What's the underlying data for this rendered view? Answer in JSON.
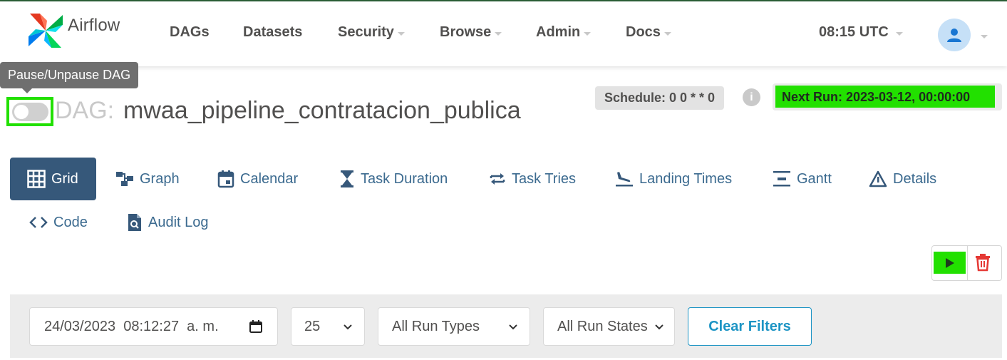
{
  "brand": {
    "name": "Airflow",
    "logo_icon": "airflow-pinwheel-icon"
  },
  "nav": {
    "items": [
      {
        "label": "DAGs",
        "dropdown": false
      },
      {
        "label": "Datasets",
        "dropdown": false
      },
      {
        "label": "Security",
        "dropdown": true
      },
      {
        "label": "Browse",
        "dropdown": true
      },
      {
        "label": "Admin",
        "dropdown": true
      },
      {
        "label": "Docs",
        "dropdown": true
      }
    ],
    "clock": "08:15 UTC",
    "user_icon": "user-icon"
  },
  "tooltip": {
    "text": "Pause/Unpause DAG"
  },
  "dag": {
    "label_prefix": "DAG:",
    "name": "mwaa_pipeline_contratacion_publica",
    "paused": true,
    "schedule": "Schedule: 0 0 * * 0",
    "info_icon": "i",
    "next_run": "Next Run: 2023-03-12, 00:00:00"
  },
  "tabs": [
    {
      "label": "Grid",
      "icon": "grid-icon",
      "active": true
    },
    {
      "label": "Graph",
      "icon": "graph-icon",
      "active": false
    },
    {
      "label": "Calendar",
      "icon": "calendar-icon",
      "active": false
    },
    {
      "label": "Task Duration",
      "icon": "hourglass-icon",
      "active": false
    },
    {
      "label": "Task Tries",
      "icon": "retry-arrows-icon",
      "active": false
    },
    {
      "label": "Landing Times",
      "icon": "plane-landing-icon",
      "active": false
    },
    {
      "label": "Gantt",
      "icon": "gantt-icon",
      "active": false
    },
    {
      "label": "Details",
      "icon": "warning-triangle-icon",
      "active": false
    },
    {
      "label": "Code",
      "icon": "code-icon",
      "active": false
    },
    {
      "label": "Audit Log",
      "icon": "audit-file-icon",
      "active": false
    }
  ],
  "actions": {
    "trigger_icon": "play-icon",
    "delete_icon": "trash-icon"
  },
  "filters": {
    "base_date": "24/03/2023  08:12:27  a. m.",
    "num_runs": "25",
    "run_type": "All Run Types",
    "run_state": "All Run States",
    "clear_label": "Clear Filters"
  },
  "colors": {
    "accent": "#36587a",
    "highlight": "#22e000",
    "link": "#1c94c4",
    "danger": "#e53935"
  }
}
